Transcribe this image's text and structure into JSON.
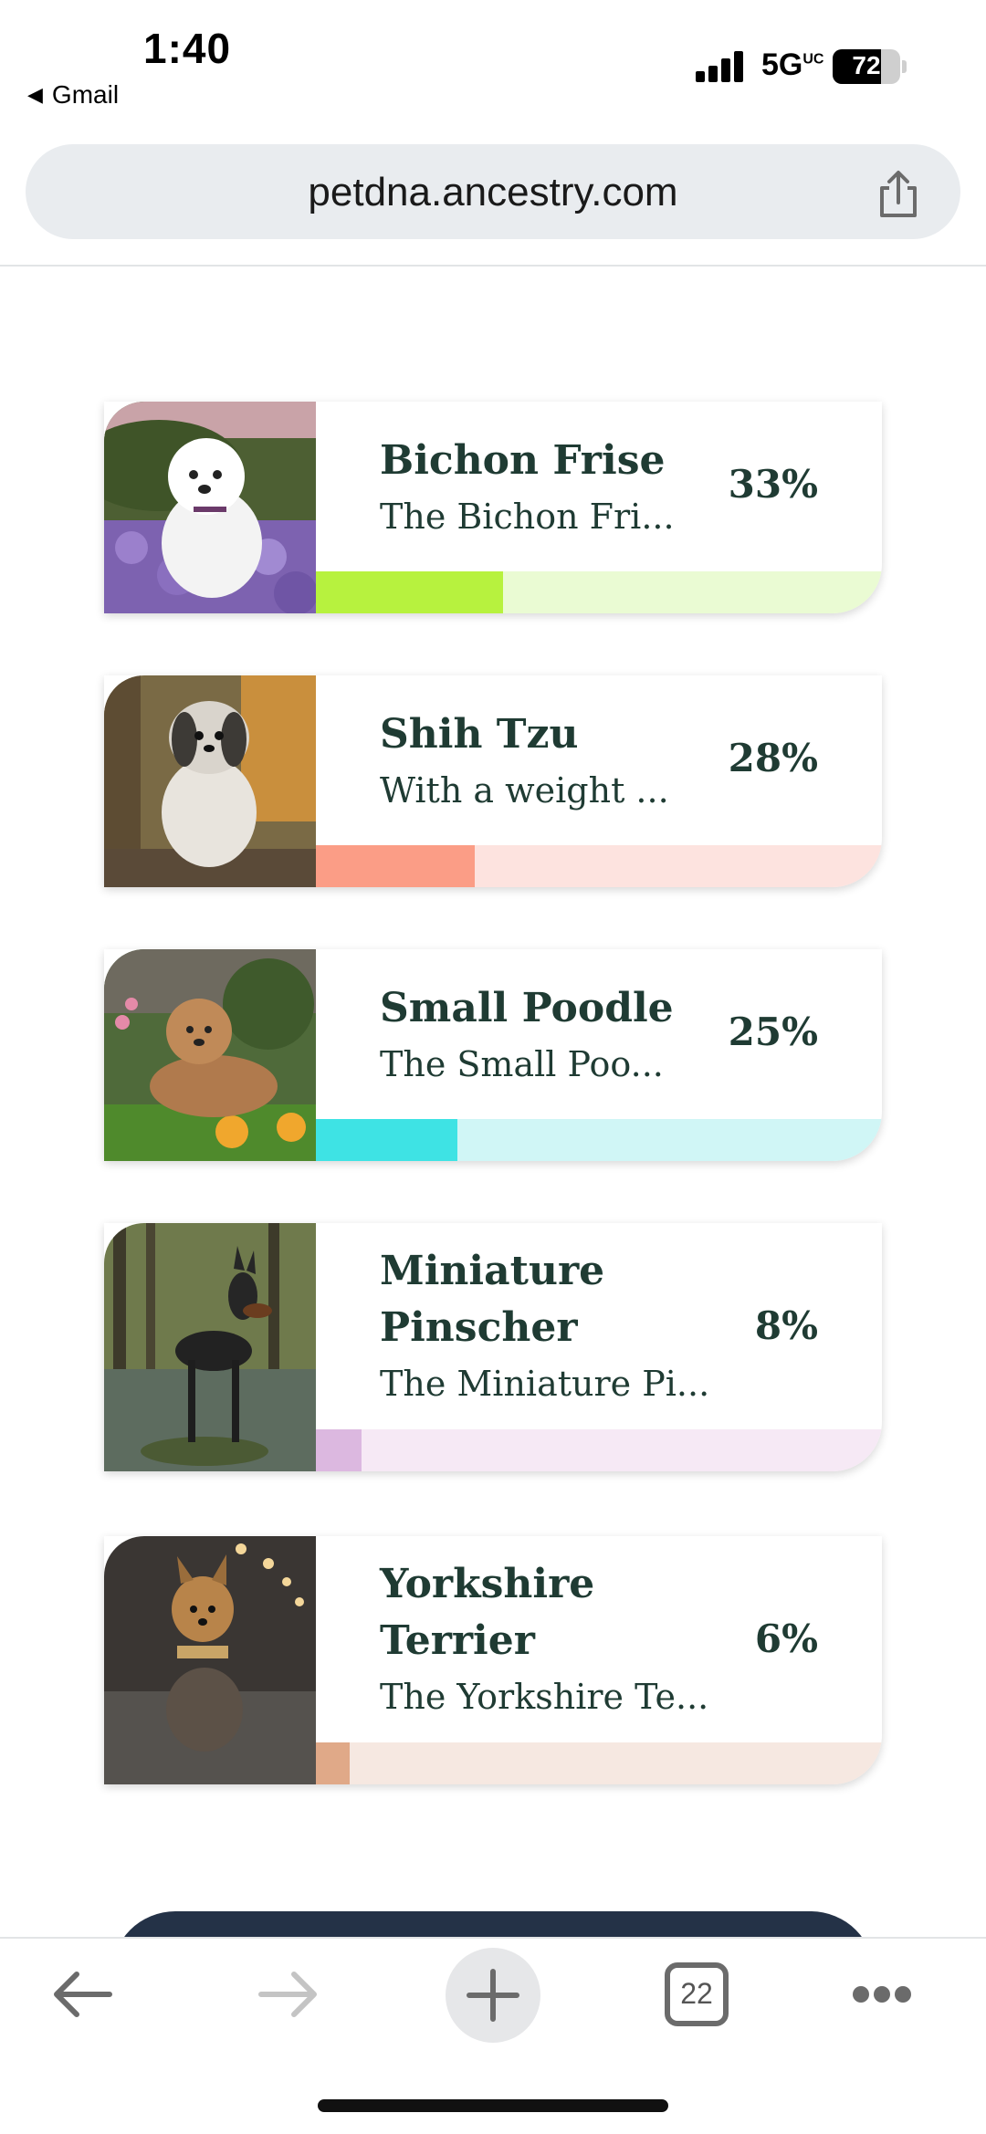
{
  "status_bar": {
    "time": "1:40",
    "back_app": "Gmail",
    "network": "5G",
    "network_suffix": "UC",
    "battery": "72",
    "battery_level": 0.72
  },
  "browser": {
    "url": "petdna.ancestry.com",
    "tabs_count": "22"
  },
  "breeds": [
    {
      "name_lines": [
        "Bichon Frise"
      ],
      "description": "The Bichon Fri...",
      "percent": "33%",
      "fraction": 0.33,
      "bar_color": "#b7f23e",
      "track_color": "#eafbd3"
    },
    {
      "name_lines": [
        "Shih Tzu"
      ],
      "description": "With a weight ...",
      "percent": "28%",
      "fraction": 0.28,
      "bar_color": "#fb9d86",
      "track_color": "#fde3df"
    },
    {
      "name_lines": [
        "Small Poodle"
      ],
      "description": "The Small Poo...",
      "percent": "25%",
      "fraction": 0.25,
      "bar_color": "#3ee3e4",
      "track_color": "#d0f6f6"
    },
    {
      "name_lines": [
        "Miniature",
        "Pinscher"
      ],
      "description": "The Miniature Pi...",
      "percent": "8%",
      "fraction": 0.08,
      "bar_color": "#dcb8e0",
      "track_color": "#f6e9f5"
    },
    {
      "name_lines": [
        "Yorkshire",
        "Terrier"
      ],
      "description": "The Yorkshire Te...",
      "percent": "6%",
      "fraction": 0.06,
      "bar_color": "#e0a988",
      "track_color": "#f6e8e1"
    }
  ],
  "icons": {
    "share": "share-icon",
    "back": "arrow-left-icon",
    "forward": "arrow-right-icon",
    "new_tab": "plus-icon",
    "tabs": "tabs-icon",
    "more": "more-icon"
  }
}
